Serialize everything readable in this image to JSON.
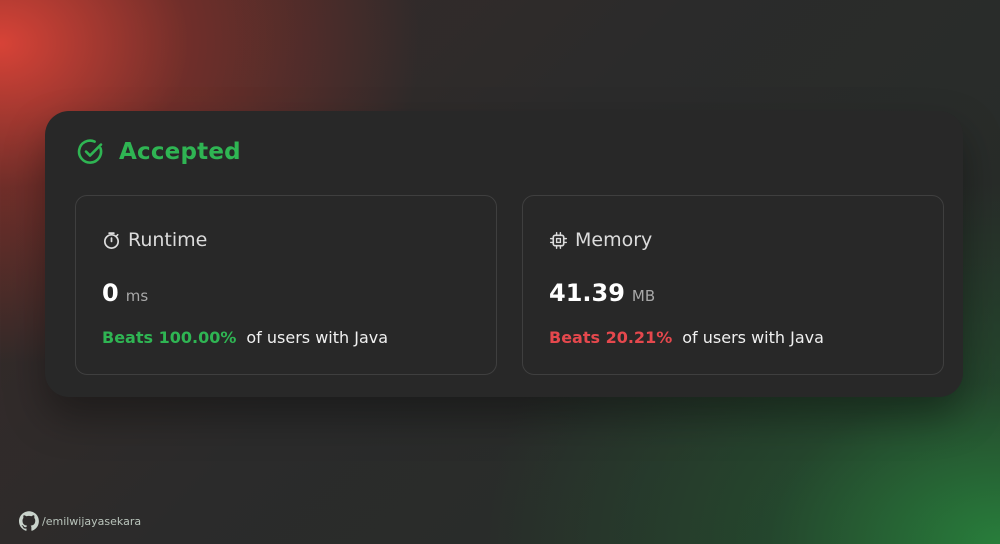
{
  "status": {
    "label": "Accepted",
    "icon": "check-circle-icon",
    "color": "#2fb553"
  },
  "runtime": {
    "title": "Runtime",
    "icon": "stopwatch-icon",
    "value": "0",
    "unit": "ms",
    "beats": "Beats 100.00%",
    "beats_suffix": "of users with Java",
    "beats_color": "#2fb553"
  },
  "memory": {
    "title": "Memory",
    "icon": "cpu-chip-icon",
    "value": "41.39",
    "unit": "MB",
    "beats": "Beats 20.21%",
    "beats_suffix": "of users with Java",
    "beats_color": "#e5484d"
  },
  "credit": {
    "icon": "github-icon",
    "text": "/emilwijayasekara"
  }
}
